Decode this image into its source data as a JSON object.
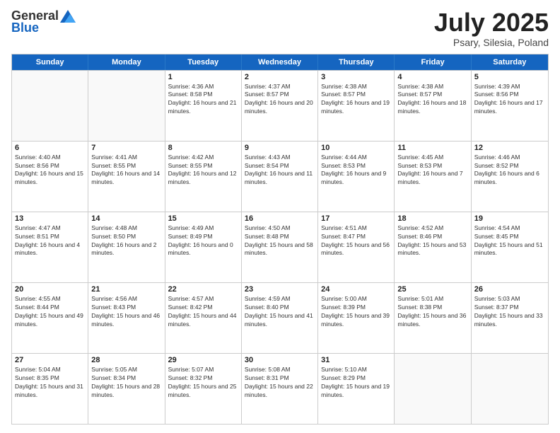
{
  "header": {
    "logo_general": "General",
    "logo_blue": "Blue",
    "month_title": "July 2025",
    "location": "Psary, Silesia, Poland"
  },
  "weekdays": [
    "Sunday",
    "Monday",
    "Tuesday",
    "Wednesday",
    "Thursday",
    "Friday",
    "Saturday"
  ],
  "rows": [
    [
      {
        "day": "",
        "sunrise": "",
        "sunset": "",
        "daylight": ""
      },
      {
        "day": "",
        "sunrise": "",
        "sunset": "",
        "daylight": ""
      },
      {
        "day": "1",
        "sunrise": "Sunrise: 4:36 AM",
        "sunset": "Sunset: 8:58 PM",
        "daylight": "Daylight: 16 hours and 21 minutes."
      },
      {
        "day": "2",
        "sunrise": "Sunrise: 4:37 AM",
        "sunset": "Sunset: 8:57 PM",
        "daylight": "Daylight: 16 hours and 20 minutes."
      },
      {
        "day": "3",
        "sunrise": "Sunrise: 4:38 AM",
        "sunset": "Sunset: 8:57 PM",
        "daylight": "Daylight: 16 hours and 19 minutes."
      },
      {
        "day": "4",
        "sunrise": "Sunrise: 4:38 AM",
        "sunset": "Sunset: 8:57 PM",
        "daylight": "Daylight: 16 hours and 18 minutes."
      },
      {
        "day": "5",
        "sunrise": "Sunrise: 4:39 AM",
        "sunset": "Sunset: 8:56 PM",
        "daylight": "Daylight: 16 hours and 17 minutes."
      }
    ],
    [
      {
        "day": "6",
        "sunrise": "Sunrise: 4:40 AM",
        "sunset": "Sunset: 8:56 PM",
        "daylight": "Daylight: 16 hours and 15 minutes."
      },
      {
        "day": "7",
        "sunrise": "Sunrise: 4:41 AM",
        "sunset": "Sunset: 8:55 PM",
        "daylight": "Daylight: 16 hours and 14 minutes."
      },
      {
        "day": "8",
        "sunrise": "Sunrise: 4:42 AM",
        "sunset": "Sunset: 8:55 PM",
        "daylight": "Daylight: 16 hours and 12 minutes."
      },
      {
        "day": "9",
        "sunrise": "Sunrise: 4:43 AM",
        "sunset": "Sunset: 8:54 PM",
        "daylight": "Daylight: 16 hours and 11 minutes."
      },
      {
        "day": "10",
        "sunrise": "Sunrise: 4:44 AM",
        "sunset": "Sunset: 8:53 PM",
        "daylight": "Daylight: 16 hours and 9 minutes."
      },
      {
        "day": "11",
        "sunrise": "Sunrise: 4:45 AM",
        "sunset": "Sunset: 8:53 PM",
        "daylight": "Daylight: 16 hours and 7 minutes."
      },
      {
        "day": "12",
        "sunrise": "Sunrise: 4:46 AM",
        "sunset": "Sunset: 8:52 PM",
        "daylight": "Daylight: 16 hours and 6 minutes."
      }
    ],
    [
      {
        "day": "13",
        "sunrise": "Sunrise: 4:47 AM",
        "sunset": "Sunset: 8:51 PM",
        "daylight": "Daylight: 16 hours and 4 minutes."
      },
      {
        "day": "14",
        "sunrise": "Sunrise: 4:48 AM",
        "sunset": "Sunset: 8:50 PM",
        "daylight": "Daylight: 16 hours and 2 minutes."
      },
      {
        "day": "15",
        "sunrise": "Sunrise: 4:49 AM",
        "sunset": "Sunset: 8:49 PM",
        "daylight": "Daylight: 16 hours and 0 minutes."
      },
      {
        "day": "16",
        "sunrise": "Sunrise: 4:50 AM",
        "sunset": "Sunset: 8:48 PM",
        "daylight": "Daylight: 15 hours and 58 minutes."
      },
      {
        "day": "17",
        "sunrise": "Sunrise: 4:51 AM",
        "sunset": "Sunset: 8:47 PM",
        "daylight": "Daylight: 15 hours and 56 minutes."
      },
      {
        "day": "18",
        "sunrise": "Sunrise: 4:52 AM",
        "sunset": "Sunset: 8:46 PM",
        "daylight": "Daylight: 15 hours and 53 minutes."
      },
      {
        "day": "19",
        "sunrise": "Sunrise: 4:54 AM",
        "sunset": "Sunset: 8:45 PM",
        "daylight": "Daylight: 15 hours and 51 minutes."
      }
    ],
    [
      {
        "day": "20",
        "sunrise": "Sunrise: 4:55 AM",
        "sunset": "Sunset: 8:44 PM",
        "daylight": "Daylight: 15 hours and 49 minutes."
      },
      {
        "day": "21",
        "sunrise": "Sunrise: 4:56 AM",
        "sunset": "Sunset: 8:43 PM",
        "daylight": "Daylight: 15 hours and 46 minutes."
      },
      {
        "day": "22",
        "sunrise": "Sunrise: 4:57 AM",
        "sunset": "Sunset: 8:42 PM",
        "daylight": "Daylight: 15 hours and 44 minutes."
      },
      {
        "day": "23",
        "sunrise": "Sunrise: 4:59 AM",
        "sunset": "Sunset: 8:40 PM",
        "daylight": "Daylight: 15 hours and 41 minutes."
      },
      {
        "day": "24",
        "sunrise": "Sunrise: 5:00 AM",
        "sunset": "Sunset: 8:39 PM",
        "daylight": "Daylight: 15 hours and 39 minutes."
      },
      {
        "day": "25",
        "sunrise": "Sunrise: 5:01 AM",
        "sunset": "Sunset: 8:38 PM",
        "daylight": "Daylight: 15 hours and 36 minutes."
      },
      {
        "day": "26",
        "sunrise": "Sunrise: 5:03 AM",
        "sunset": "Sunset: 8:37 PM",
        "daylight": "Daylight: 15 hours and 33 minutes."
      }
    ],
    [
      {
        "day": "27",
        "sunrise": "Sunrise: 5:04 AM",
        "sunset": "Sunset: 8:35 PM",
        "daylight": "Daylight: 15 hours and 31 minutes."
      },
      {
        "day": "28",
        "sunrise": "Sunrise: 5:05 AM",
        "sunset": "Sunset: 8:34 PM",
        "daylight": "Daylight: 15 hours and 28 minutes."
      },
      {
        "day": "29",
        "sunrise": "Sunrise: 5:07 AM",
        "sunset": "Sunset: 8:32 PM",
        "daylight": "Daylight: 15 hours and 25 minutes."
      },
      {
        "day": "30",
        "sunrise": "Sunrise: 5:08 AM",
        "sunset": "Sunset: 8:31 PM",
        "daylight": "Daylight: 15 hours and 22 minutes."
      },
      {
        "day": "31",
        "sunrise": "Sunrise: 5:10 AM",
        "sunset": "Sunset: 8:29 PM",
        "daylight": "Daylight: 15 hours and 19 minutes."
      },
      {
        "day": "",
        "sunrise": "",
        "sunset": "",
        "daylight": ""
      },
      {
        "day": "",
        "sunrise": "",
        "sunset": "",
        "daylight": ""
      }
    ]
  ]
}
